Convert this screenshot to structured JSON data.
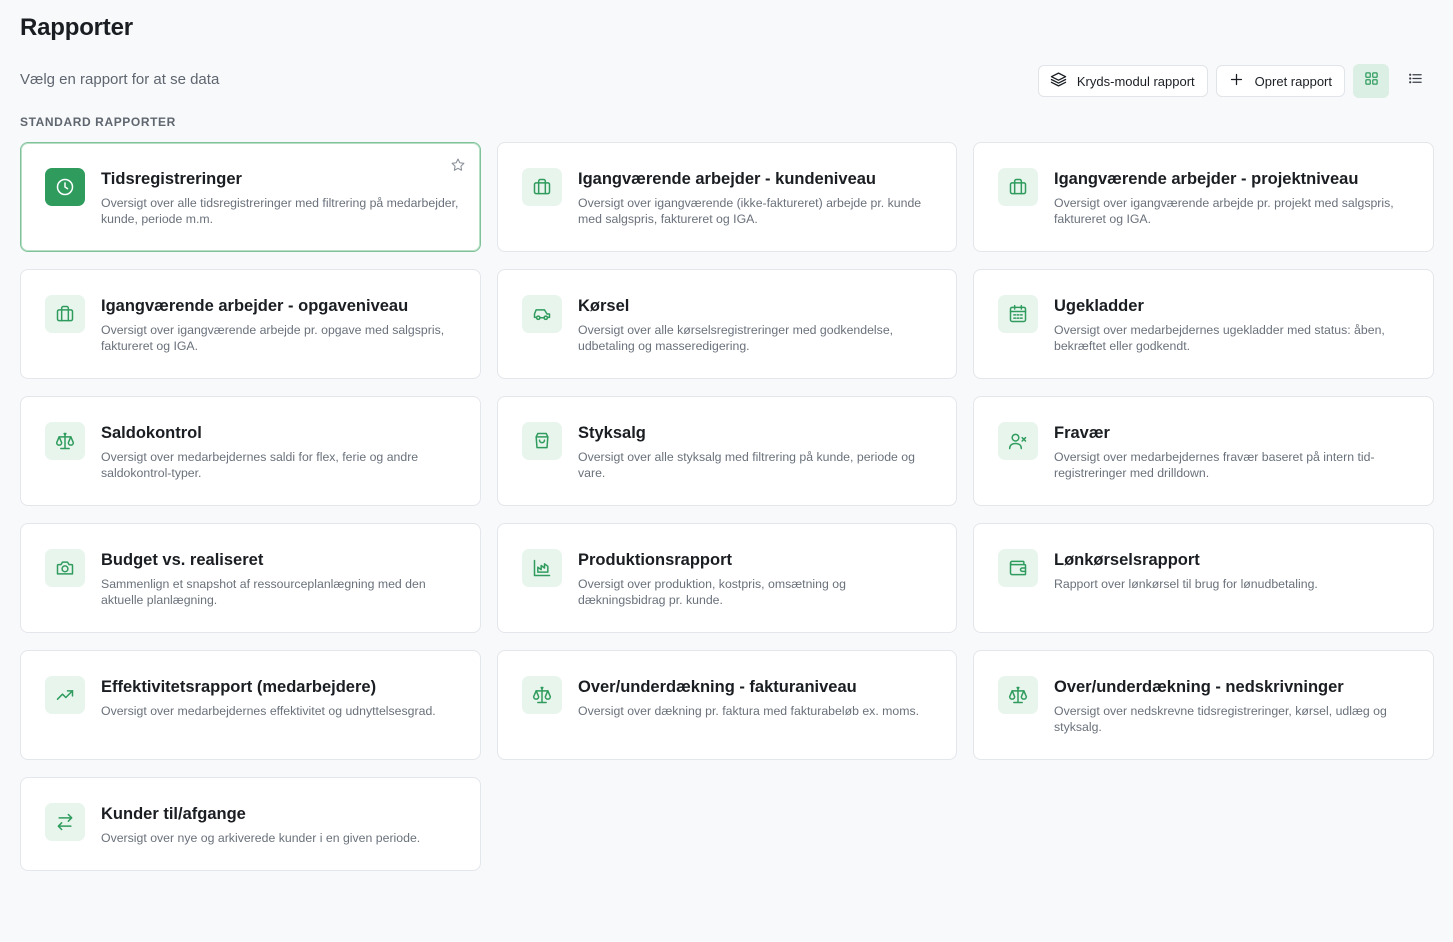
{
  "header": {
    "title": "Rapporter",
    "subtitle": "Vælg en rapport for at se data",
    "buttons": {
      "cross_module": "Kryds-modul rapport",
      "create": "Opret rapport"
    }
  },
  "section_label": "STANDARD RAPPORTER",
  "colors": {
    "accent": "#2f9c5e",
    "tile_bg": "#e8f5ed",
    "active_view_bg": "#dcefe4"
  },
  "reports": [
    {
      "title": "Tidsregistreringer",
      "desc": "Oversigt over alle tidsregistreringer med filtrering på medarbejder, kunde, periode m.m.",
      "icon": "clock-icon"
    },
    {
      "title": "Igangværende arbejder - kundeniveau",
      "desc": "Oversigt over igangværende (ikke-faktureret) arbejde pr. kunde med salgspris, faktureret og IGA.",
      "icon": "briefcase-icon"
    },
    {
      "title": "Igangværende arbejder - projektniveau",
      "desc": "Oversigt over igangværende arbejde pr. projekt med salgspris, faktureret og IGA.",
      "icon": "briefcase-icon"
    },
    {
      "title": "Igangværende arbejder - opgaveniveau",
      "desc": "Oversigt over igangværende arbejde pr. opgave med salgspris, faktureret og IGA.",
      "icon": "briefcase-icon"
    },
    {
      "title": "Kørsel",
      "desc": "Oversigt over alle kørselsregistreringer med godkendelse, udbetaling og masseredigering.",
      "icon": "car-icon"
    },
    {
      "title": "Ugekladder",
      "desc": "Oversigt over medarbejdernes ugekladder med status: åben, bekræftet eller godkendt.",
      "icon": "calendar-icon"
    },
    {
      "title": "Saldokontrol",
      "desc": "Oversigt over medarbejdernes saldi for flex, ferie og andre saldokontrol-typer.",
      "icon": "scale-icon"
    },
    {
      "title": "Styksalg",
      "desc": "Oversigt over alle styksalg med filtrering på kunde, periode og vare.",
      "icon": "shopping-bag-icon"
    },
    {
      "title": "Fravær",
      "desc": "Oversigt over medarbejdernes fravær baseret på intern tid-registreringer med drilldown.",
      "icon": "user-x-icon"
    },
    {
      "title": "Budget vs. realiseret",
      "desc": "Sammenlign et snapshot af ressourceplanlægning med den aktuelle planlægning.",
      "icon": "camera-icon"
    },
    {
      "title": "Produktionsrapport",
      "desc": "Oversigt over produktion, kostpris, omsætning og dækningsbidrag pr. kunde.",
      "icon": "factory-chart-icon"
    },
    {
      "title": "Lønkørselsrapport",
      "desc": "Rapport over lønkørsel til brug for lønudbetaling.",
      "icon": "wallet-icon"
    },
    {
      "title": "Effektivitetsrapport (medarbejdere)",
      "desc": "Oversigt over medarbejdernes effektivitet og udnyttelsesgrad.",
      "icon": "trending-up-icon"
    },
    {
      "title": "Over/underdækning - fakturaniveau",
      "desc": "Oversigt over dækning pr. faktura med fakturabeløb ex. moms.",
      "icon": "scale-icon"
    },
    {
      "title": "Over/underdækning - nedskrivninger",
      "desc": "Oversigt over nedskrevne tidsregistreringer, kørsel, udlæg og styksalg.",
      "icon": "scale-icon"
    },
    {
      "title": "Kunder til/afgange",
      "desc": "Oversigt over nye og arkiverede kunder i en given periode.",
      "icon": "arrows-swap-icon"
    }
  ]
}
